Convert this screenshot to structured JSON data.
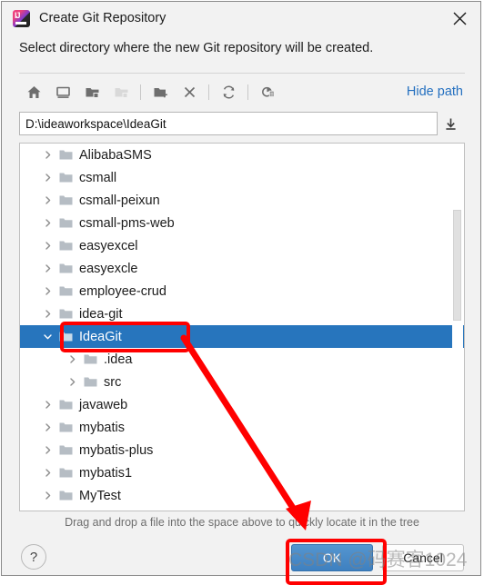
{
  "window": {
    "title": "Create Git Repository",
    "app_icon": "intellij-idea-icon",
    "close_label": "✕"
  },
  "subtitle": "Select directory where the new Git repository will be created.",
  "toolbar": {
    "buttons": [
      {
        "name": "home-icon",
        "title": "Home",
        "disabled": false
      },
      {
        "name": "desktop-icon",
        "title": "Desktop",
        "disabled": false
      },
      {
        "name": "project-folder-icon",
        "title": "Project Directory",
        "disabled": false
      },
      {
        "name": "module-folder-icon",
        "title": "Module Directory",
        "disabled": true
      },
      {
        "name": "new-folder-icon",
        "title": "New Folder",
        "disabled": false
      },
      {
        "name": "delete-icon",
        "title": "Delete",
        "disabled": false
      },
      {
        "name": "refresh-icon",
        "title": "Refresh",
        "disabled": false
      },
      {
        "name": "show-hidden-icon",
        "title": "Show Hidden Files",
        "disabled": false
      }
    ],
    "hide_path_label": "Hide path"
  },
  "path_field": {
    "value": "D:\\ideaworkspace\\IdeaGit",
    "placeholder": "",
    "dropdown_icon": "download-expand-icon"
  },
  "tree": {
    "rows": [
      {
        "label": "AlibabaSMS",
        "indent": 0,
        "expanded": false,
        "selected": false
      },
      {
        "label": "csmall",
        "indent": 0,
        "expanded": false,
        "selected": false
      },
      {
        "label": "csmall-peixun",
        "indent": 0,
        "expanded": false,
        "selected": false
      },
      {
        "label": "csmall-pms-web",
        "indent": 0,
        "expanded": false,
        "selected": false
      },
      {
        "label": "easyexcel",
        "indent": 0,
        "expanded": false,
        "selected": false
      },
      {
        "label": "easyexcle",
        "indent": 0,
        "expanded": false,
        "selected": false
      },
      {
        "label": "employee-crud",
        "indent": 0,
        "expanded": false,
        "selected": false
      },
      {
        "label": "idea-git",
        "indent": 0,
        "expanded": false,
        "selected": false
      },
      {
        "label": "IdeaGit",
        "indent": 0,
        "expanded": true,
        "selected": true
      },
      {
        "label": ".idea",
        "indent": 1,
        "expanded": false,
        "selected": false
      },
      {
        "label": "src",
        "indent": 1,
        "expanded": false,
        "selected": false
      },
      {
        "label": "javaweb",
        "indent": 0,
        "expanded": false,
        "selected": false
      },
      {
        "label": "mybatis",
        "indent": 0,
        "expanded": false,
        "selected": false
      },
      {
        "label": "mybatis-plus",
        "indent": 0,
        "expanded": false,
        "selected": false
      },
      {
        "label": "mybatis1",
        "indent": 0,
        "expanded": false,
        "selected": false
      },
      {
        "label": "MyTest",
        "indent": 0,
        "expanded": false,
        "selected": false
      },
      {
        "label": "",
        "indent": 0,
        "expanded": false,
        "selected": false
      }
    ],
    "selection_color": "#2775bd"
  },
  "hint": "Drag and drop a file into the space above to quickly locate it in the tree",
  "footer": {
    "help_label": "?",
    "ok_label": "OK",
    "cancel_label": "Cancel"
  },
  "annotations": {
    "color": "#ff0000",
    "highlight_tree_item": "IdeaGit",
    "highlight_button": "OK"
  },
  "watermark": "CSDN @码赛客1024"
}
